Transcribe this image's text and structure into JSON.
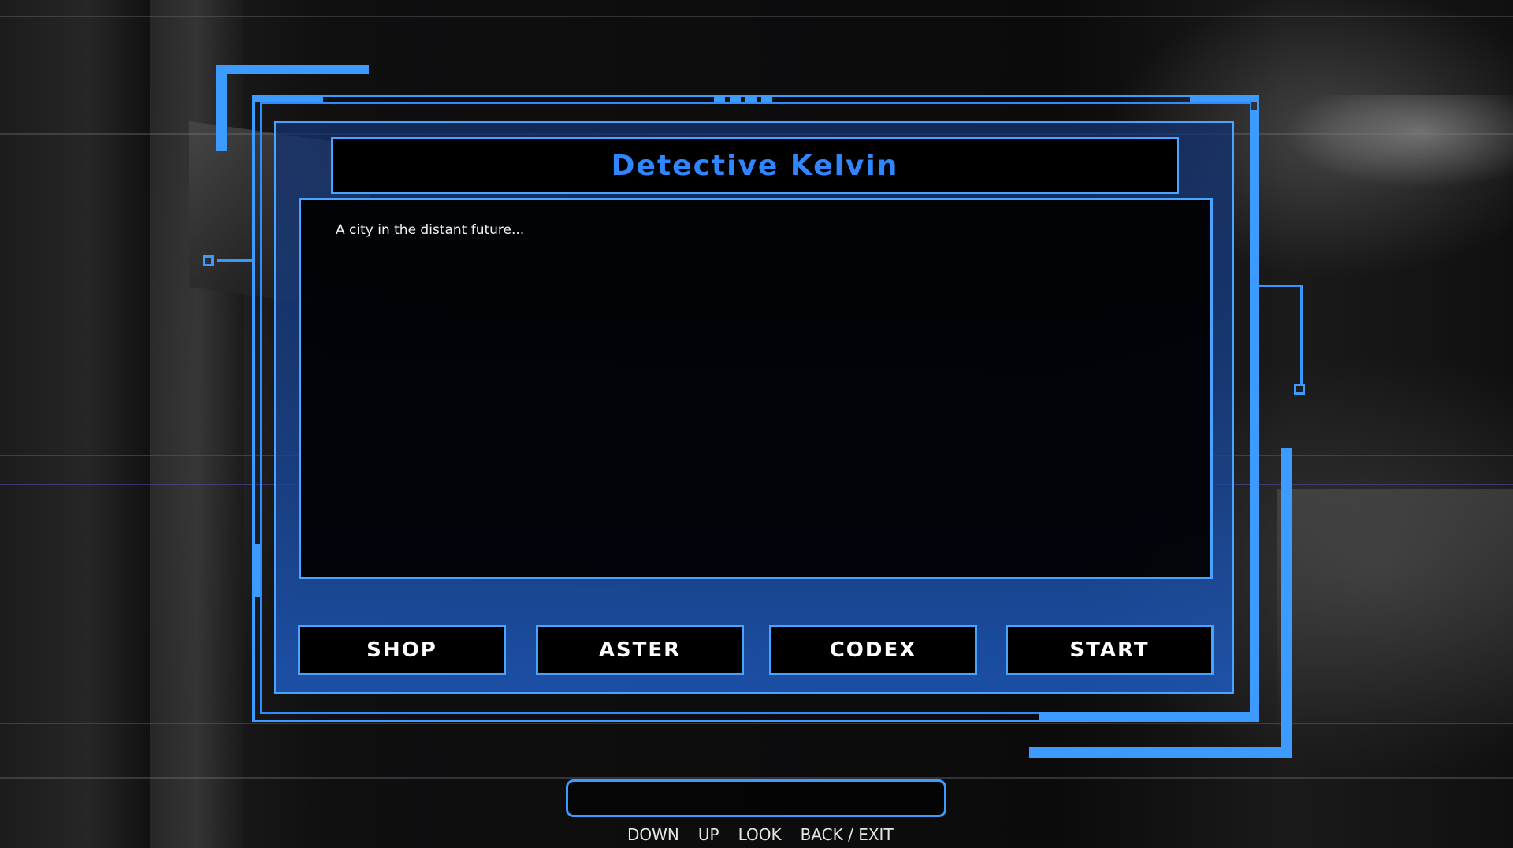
{
  "dialog": {
    "title": "Detective Kelvin",
    "text": "A city in the distant future..."
  },
  "menu": {
    "buttons": [
      {
        "label": "SHOP"
      },
      {
        "label": "ASTER"
      },
      {
        "label": "CODEX"
      },
      {
        "label": "START"
      }
    ]
  },
  "input": {
    "value": ""
  },
  "controls": [
    "DOWN",
    "UP",
    "LOOK",
    "BACK / EXIT"
  ],
  "colors": {
    "accent": "#3d9bff",
    "title": "#2f86ff",
    "panel": "#1b4a9e",
    "text": "#f2f2f2"
  }
}
